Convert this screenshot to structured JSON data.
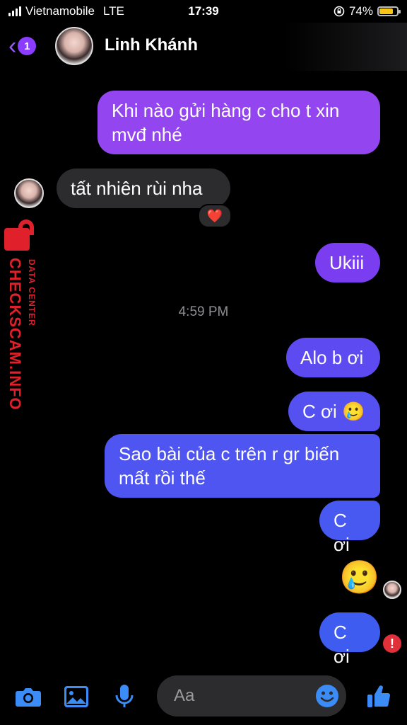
{
  "status_bar": {
    "carrier": "Vietnamobile",
    "network": "LTE",
    "time": "17:39",
    "battery": "74%",
    "battery_level": 0.74
  },
  "header": {
    "back_count": "1",
    "contact_name": "Linh Khánh"
  },
  "messages": [
    {
      "side": "outgoing",
      "text": "Khi nào gửi hàng c cho t xin mvđ nhé"
    },
    {
      "side": "incoming",
      "text": "tất nhiên rùi nha",
      "reaction": "❤️"
    },
    {
      "side": "outgoing",
      "text": "Ukiii"
    },
    {
      "side": "outgoing",
      "text": "Alo b ơi"
    },
    {
      "side": "outgoing",
      "text": "C ơi 🥲"
    },
    {
      "side": "outgoing",
      "text": "Sao bài của c trên r gr biến mất rồi thế"
    },
    {
      "side": "outgoing",
      "text": "C ơi"
    },
    {
      "side": "outgoing",
      "text": "🥲"
    },
    {
      "side": "outgoing",
      "text": "C ơi"
    }
  ],
  "timestamp": "4:59 PM",
  "watermark": {
    "main": "CHECKSCAM.INFO",
    "sub": "DATA CENTER"
  },
  "composer": {
    "placeholder": "Aa"
  },
  "colors": {
    "accent": "#8b3dff",
    "bubble_top": "#9b46f0",
    "bubble_bottom": "#3f5cf0",
    "incoming_bubble": "#2c2c2e",
    "toolbar_icon": "#3b8cf6",
    "error": "#e0303a"
  },
  "icons": [
    "camera-icon",
    "image-icon",
    "microphone-icon",
    "emoji-icon",
    "thumbs-up-icon"
  ]
}
